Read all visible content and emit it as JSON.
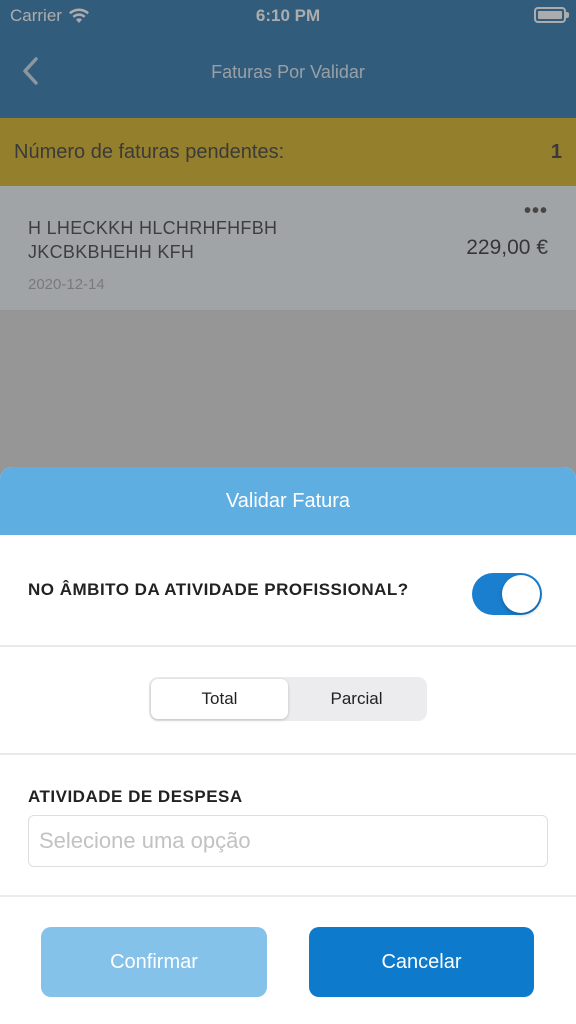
{
  "status_bar": {
    "carrier": "Carrier",
    "time": "6:10 PM"
  },
  "nav": {
    "title": "Faturas Por Validar"
  },
  "pending": {
    "label": "Número de faturas pendentes:",
    "count": "1"
  },
  "invoice": {
    "name": "H LHECKKH HLCHRHFHFBH JKCBKBHEHH KFH",
    "amount": "229,00 €",
    "date": "2020-12-14",
    "more": "•••"
  },
  "sheet": {
    "title": "Validar Fatura",
    "professional_label": "NO ÂMBITO DA ATIVIDADE PROFISSIONAL?",
    "professional_on": true,
    "segments": [
      "Total",
      "Parcial"
    ],
    "selected_segment": "Total",
    "despesa_label": "ATIVIDADE DE DESPESA",
    "despesa_placeholder": "Selecione uma opção",
    "confirm_label": "Confirmar",
    "cancel_label": "Cancelar"
  },
  "colors": {
    "nav": "#0b5f9e",
    "pending": "#cfa400",
    "sheet_header": "#5eaee2",
    "toggle_on": "#1a7fcf",
    "confirm_disabled": "#84c2ea",
    "cancel": "#0d7acc"
  },
  "icons": [
    "wifi-icon",
    "battery-icon",
    "back-chevron-icon",
    "more-icon"
  ]
}
